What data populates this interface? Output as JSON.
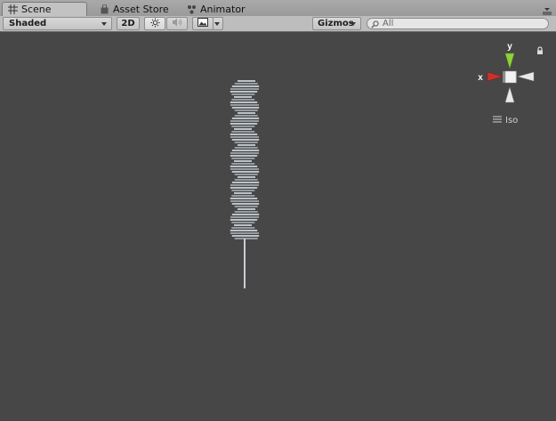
{
  "tabs": [
    {
      "label": "Scene",
      "icon": "grid-icon",
      "active": true
    },
    {
      "label": "Asset Store",
      "icon": "shopping-bag-icon",
      "active": false
    },
    {
      "label": "Animator",
      "icon": "animator-icon",
      "active": false
    }
  ],
  "toolbar": {
    "draw_mode": "Shaded",
    "mode_2d": "2D",
    "gizmos": "Gizmos",
    "search_placeholder": "All"
  },
  "scene_gizmo": {
    "y_label": "y",
    "x_label": "x",
    "projection": "Iso",
    "colors": {
      "y_axis": "#8fd13a",
      "x_axis": "#c8332b"
    }
  }
}
